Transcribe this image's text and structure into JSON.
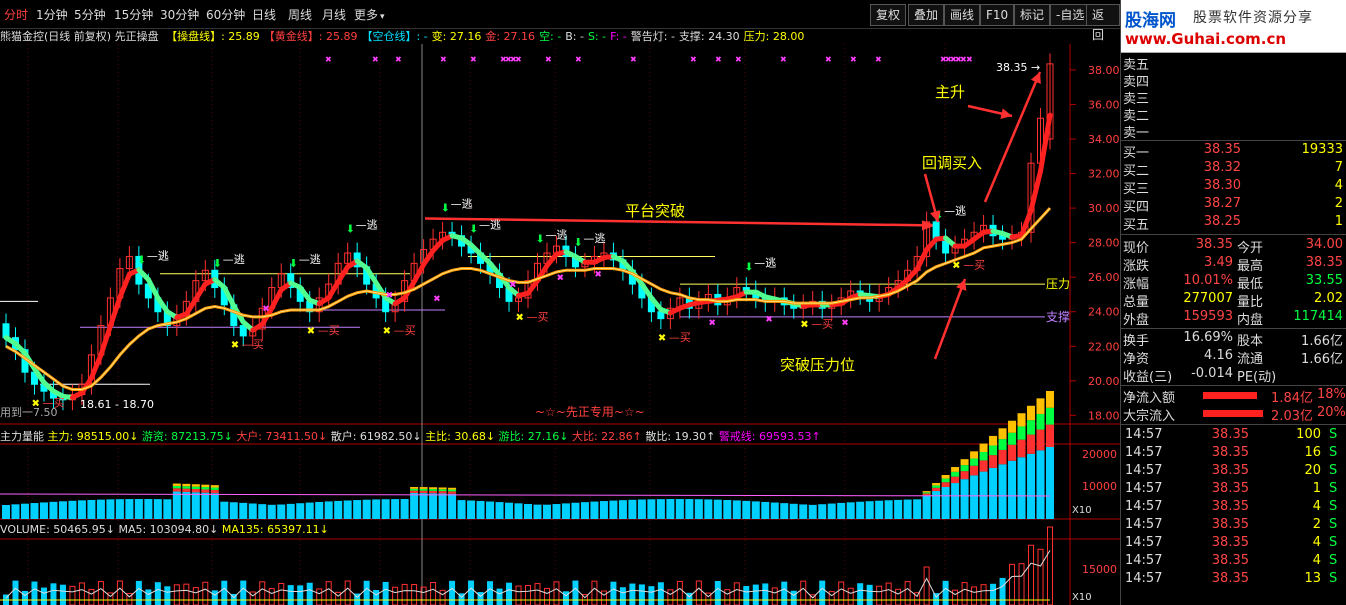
{
  "toolbar": {
    "periods": [
      {
        "label": "分时",
        "active": true
      },
      {
        "label": "1分钟",
        "active": false
      },
      {
        "label": "5分钟",
        "active": false
      },
      {
        "label": "15分钟",
        "active": false
      },
      {
        "label": "30分钟",
        "active": false
      },
      {
        "label": "60分钟",
        "active": false
      },
      {
        "label": "日线",
        "active": false
      },
      {
        "label": "周线",
        "active": false
      },
      {
        "label": "月线",
        "active": false
      },
      {
        "label": "更多",
        "active": false
      }
    ],
    "more_arrow": "▾",
    "right_buttons": [
      "复权",
      "叠加",
      "画线",
      "F10",
      "标记",
      "-自选",
      "返回"
    ]
  },
  "brand": {
    "name": "股海网",
    "slogan": "股票软件资源分享",
    "url": "www.Guhai.com.cn"
  },
  "info": {
    "title": "熊猫金控(日线 前复权) 先正操盘",
    "items": [
      {
        "label": "【操盘线】: 25.89",
        "color": "#ffff00"
      },
      {
        "label": "【黄金线】: 25.89",
        "color": "#ff4040"
      },
      {
        "label": "【空仓线】: -",
        "color": "#00e0ff"
      },
      {
        "label": "变: 27.16",
        "color": "#ffff00"
      },
      {
        "label": "金: 27.16",
        "color": "#ff4040"
      },
      {
        "label": "空: -",
        "color": "#00ff40"
      },
      {
        "label": "B: -",
        "color": "#ddd"
      },
      {
        "label": "S: -",
        "color": "#00ff40"
      },
      {
        "label": "F: -",
        "color": "#ff00ff"
      },
      {
        "label": "警告灯: -",
        "color": "#ddd"
      },
      {
        "label": "支撑: 24.30",
        "color": "#ddd"
      },
      {
        "label": "压力: 28.00",
        "color": "#ffff00"
      }
    ]
  },
  "colors": {
    "up": "#ff3030",
    "down": "#00ffff",
    "ma_main": "#ff9a00",
    "signal_green": "#50ff90"
  },
  "chart_data": {
    "type": "line",
    "price_axis": [
      "38.00",
      "36.00",
      "34.00",
      "32.00",
      "30.00",
      "28.00",
      "26.00",
      "24.00",
      "22.00",
      "20.00",
      "18.00"
    ],
    "ylim": [
      17.5,
      39.5
    ],
    "max_price_label": "38.35",
    "low_label": "18.61 - 18.70",
    "watermark": "~☆~先正专用~☆~",
    "left_caption": "用到一7.50",
    "annotations": {
      "main_rise": "主升",
      "pullback_buy": "回调买入",
      "platform_breakout": "平台突破",
      "break_resistance": "突破压力位",
      "resistance_tag": "压力",
      "support_tag": "支撑",
      "escape_tag": "逃",
      "buy_tag": "买"
    },
    "closes": [
      22.5,
      21.8,
      20.5,
      19.8,
      19.4,
      19.0,
      18.9,
      19.2,
      19.8,
      21.5,
      23.2,
      24.8,
      26.5,
      27.2,
      25.6,
      24.8,
      24.0,
      23.2,
      23.8,
      24.6,
      25.8,
      26.4,
      25.4,
      24.4,
      23.2,
      22.6,
      23.0,
      24.2,
      25.4,
      26.2,
      25.4,
      24.6,
      24.0,
      24.8,
      25.6,
      26.8,
      27.4,
      26.6,
      25.6,
      24.8,
      24.0,
      24.6,
      25.8,
      26.8,
      27.6,
      28.2,
      28.6,
      28.4,
      27.8,
      27.4,
      26.8,
      26.2,
      25.4,
      24.6,
      24.8,
      25.8,
      26.8,
      27.4,
      27.8,
      27.2,
      26.6,
      26.8,
      27.2,
      27.4,
      27.0,
      26.4,
      25.6,
      24.8,
      24.0,
      23.6,
      24.2,
      24.8,
      24.2,
      24.6,
      25.0,
      24.4,
      24.8,
      25.4,
      25.2,
      24.8,
      24.6,
      24.8,
      24.4,
      24.2,
      24.4,
      24.6,
      24.2,
      24.4,
      24.8,
      25.2,
      25.0,
      24.6,
      25.0,
      25.4,
      25.8,
      26.4,
      27.2,
      29.2,
      28.2,
      27.4,
      27.8,
      28.2,
      28.6,
      29.0,
      28.4,
      28.2,
      28.4,
      28.6,
      32.6,
      35.2,
      38.35
    ],
    "ma": [
      22.0,
      21.7,
      21.3,
      20.9,
      20.5,
      20.1,
      19.7,
      19.5,
      19.5,
      19.7,
      20.2,
      20.8,
      21.5,
      22.1,
      22.6,
      23.0,
      23.2,
      23.3,
      23.4,
      23.6,
      23.9,
      24.2,
      24.3,
      24.2,
      24.0,
      23.8,
      23.7,
      23.7,
      23.8,
      24.0,
      24.1,
      24.1,
      24.1,
      24.1,
      24.3,
      24.6,
      24.9,
      25.1,
      25.2,
      25.1,
      25.0,
      25.0,
      25.1,
      25.3,
      25.6,
      25.9,
      26.2,
      26.4,
      26.5,
      26.5,
      26.4,
      26.2,
      26.0,
      25.8,
      25.7,
      25.7,
      25.9,
      26.1,
      26.3,
      26.4,
      26.4,
      26.4,
      26.5,
      26.5,
      26.5,
      26.4,
      26.2,
      25.9,
      25.6,
      25.3,
      25.1,
      25.0,
      24.8,
      24.7,
      24.7,
      24.6,
      24.6,
      24.7,
      24.7,
      24.7,
      24.6,
      24.6,
      24.6,
      24.5,
      24.5,
      24.5,
      24.5,
      24.5,
      24.6,
      24.7,
      24.8,
      24.8,
      24.9,
      25.0,
      25.2,
      25.5,
      25.8,
      26.3,
      26.6,
      26.8,
      27.0,
      27.2,
      27.4,
      27.7,
      27.8,
      27.9,
      28.0,
      28.2,
      28.8,
      29.4,
      30.0
    ],
    "resistance_level": 25.6,
    "support_level": 23.7
  },
  "indicator1": {
    "title": "主力量能",
    "items": [
      {
        "label": "主力: 98515.00↓",
        "color": "#ffff00"
      },
      {
        "label": "游资: 87213.75↓",
        "color": "#00ff40"
      },
      {
        "label": "大户: 73411.50↓",
        "color": "#ff4040"
      },
      {
        "label": "散户: 61982.50↓",
        "color": "#ddd"
      },
      {
        "label": "主比: 30.68↓",
        "color": "#ffff00"
      },
      {
        "label": "游比: 27.16↓",
        "color": "#00ff40"
      },
      {
        "label": "大比: 22.86↑",
        "color": "#ff4040"
      },
      {
        "label": "散比: 19.30↑",
        "color": "#ddd"
      },
      {
        "label": "警戒线: 69593.53↑",
        "color": "#ff00ff"
      }
    ],
    "axis": [
      "20000",
      "10000"
    ],
    "scale": "X10"
  },
  "indicator2": {
    "items": [
      {
        "label": "VOLUME: 50465.95↓",
        "color": "#ddd"
      },
      {
        "label": "MA5: 103094.80↓",
        "color": "#ddd"
      },
      {
        "label": "MA135: 65397.11↓",
        "color": "#ffff00"
      }
    ],
    "axis": [
      "15000"
    ],
    "scale": "X10"
  },
  "orderbook": {
    "sells": [
      {
        "label": "卖五",
        "price": "",
        "vol": ""
      },
      {
        "label": "卖四",
        "price": "",
        "vol": ""
      },
      {
        "label": "卖三",
        "price": "",
        "vol": ""
      },
      {
        "label": "卖二",
        "price": "",
        "vol": ""
      },
      {
        "label": "卖一",
        "price": "",
        "vol": ""
      }
    ],
    "buys": [
      {
        "label": "买一",
        "price": "38.35",
        "vol": "19333"
      },
      {
        "label": "买二",
        "price": "38.32",
        "vol": "7"
      },
      {
        "label": "买三",
        "price": "38.30",
        "vol": "4"
      },
      {
        "label": "买四",
        "price": "38.27",
        "vol": "2"
      },
      {
        "label": "买五",
        "price": "38.25",
        "vol": "1"
      }
    ]
  },
  "quote": [
    {
      "l1": "现价",
      "v1": "38.35",
      "c1": "red",
      "l2": "今开",
      "v2": "34.00",
      "c2": "red"
    },
    {
      "l1": "涨跌",
      "v1": "3.49",
      "c1": "red",
      "l2": "最高",
      "v2": "38.35",
      "c2": "red"
    },
    {
      "l1": "涨幅",
      "v1": "10.01%",
      "c1": "red",
      "l2": "最低",
      "v2": "33.55",
      "c2": "green"
    },
    {
      "l1": "总量",
      "v1": "277007",
      "c1": "yellow",
      "l2": "量比",
      "v2": "2.02",
      "c2": "yellow"
    },
    {
      "l1": "外盘",
      "v1": "159593",
      "c1": "red",
      "l2": "内盘",
      "v2": "117414",
      "c2": "green"
    }
  ],
  "quote2": [
    {
      "l1": "换手",
      "v1": "16.69%",
      "c1": "white",
      "l2": "股本",
      "v2": "1.66亿",
      "c2": "white"
    },
    {
      "l1": "净资",
      "v1": "4.16",
      "c1": "white",
      "l2": "流通",
      "v2": "1.66亿",
      "c2": "white"
    },
    {
      "l1": "收益(三)",
      "v1": "-0.014",
      "c1": "white",
      "l2": "PE(动)",
      "v2": "",
      "c2": "white"
    }
  ],
  "flows": [
    {
      "label": "净流入额",
      "value": "1.84亿",
      "pct": "18%",
      "ratio": 0.18
    },
    {
      "label": "大宗流入",
      "value": "2.03亿",
      "pct": "20%",
      "ratio": 0.2
    }
  ],
  "ticks": [
    {
      "time": "14:57",
      "price": "38.35",
      "vol": "100",
      "side": "S"
    },
    {
      "time": "14:57",
      "price": "38.35",
      "vol": "16",
      "side": "S"
    },
    {
      "time": "14:57",
      "price": "38.35",
      "vol": "20",
      "side": "S"
    },
    {
      "time": "14:57",
      "price": "38.35",
      "vol": "1",
      "side": "S"
    },
    {
      "time": "14:57",
      "price": "38.35",
      "vol": "4",
      "side": "S"
    },
    {
      "time": "14:57",
      "price": "38.35",
      "vol": "2",
      "side": "S"
    },
    {
      "time": "14:57",
      "price": "38.35",
      "vol": "4",
      "side": "S"
    },
    {
      "time": "14:57",
      "price": "38.35",
      "vol": "4",
      "side": "S"
    },
    {
      "time": "14:57",
      "price": "38.35",
      "vol": "13",
      "side": "S"
    }
  ]
}
